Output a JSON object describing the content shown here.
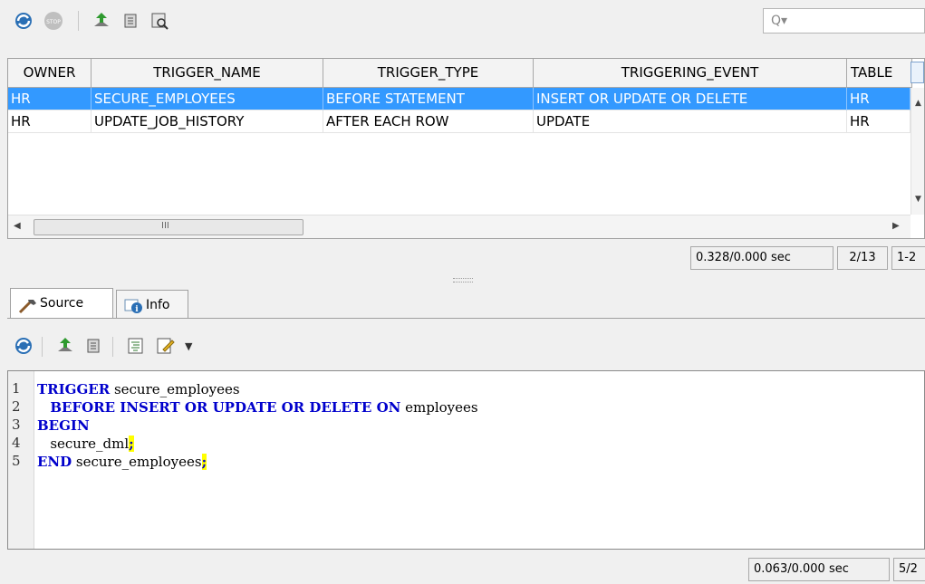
{
  "toolbar": {
    "icons": [
      "refresh-icon",
      "stop-icon",
      "export-icon",
      "freeze-icon",
      "filter-icon"
    ],
    "search_glyph": "Q▾"
  },
  "grid": {
    "columns": [
      "OWNER",
      "TRIGGER_NAME",
      "TRIGGER_TYPE",
      "TRIGGERING_EVENT",
      "TABLE"
    ],
    "rows": [
      {
        "owner": "HR",
        "trigger_name": "SECURE_EMPLOYEES",
        "trigger_type": "BEFORE STATEMENT",
        "triggering_event": "INSERT OR UPDATE OR DELETE",
        "table": "HR",
        "selected": true
      },
      {
        "owner": "HR",
        "trigger_name": "UPDATE_JOB_HISTORY",
        "trigger_type": "AFTER EACH ROW",
        "triggering_event": "UPDATE",
        "table": "HR",
        "selected": false
      }
    ],
    "hscroll_grip": "III",
    "colors": {
      "selection": "#3399ff",
      "keyword": "#0000cc",
      "highlight": "#ffff00"
    }
  },
  "status_top": {
    "timing": "0.328/0.000 sec",
    "record": "2/13",
    "range": "1-2"
  },
  "tabs": [
    {
      "label": "Source",
      "icon": "hammer-icon",
      "active": true
    },
    {
      "label": "Info",
      "icon": "info-icon",
      "active": false
    }
  ],
  "editor": {
    "lines": [
      {
        "num": "1",
        "indent": " ",
        "kw1": "TRIGGER",
        "text": " secure_employees",
        "semi": ""
      },
      {
        "num": "2",
        "indent": "   ",
        "kw1": "BEFORE INSERT OR UPDATE OR DELETE ON",
        "text": " employees",
        "semi": ""
      },
      {
        "num": "3",
        "indent": " ",
        "kw1": "BEGIN",
        "text": "",
        "semi": ""
      },
      {
        "num": "4",
        "indent": "  ",
        "kw1": "",
        "text": " secure_dml",
        "semi": ";"
      },
      {
        "num": "5",
        "indent": " ",
        "kw1": "END",
        "text": " secure_employees",
        "semi": ";"
      }
    ]
  },
  "status_bottom": {
    "timing": "0.063/0.000 sec",
    "record": "5/2"
  }
}
